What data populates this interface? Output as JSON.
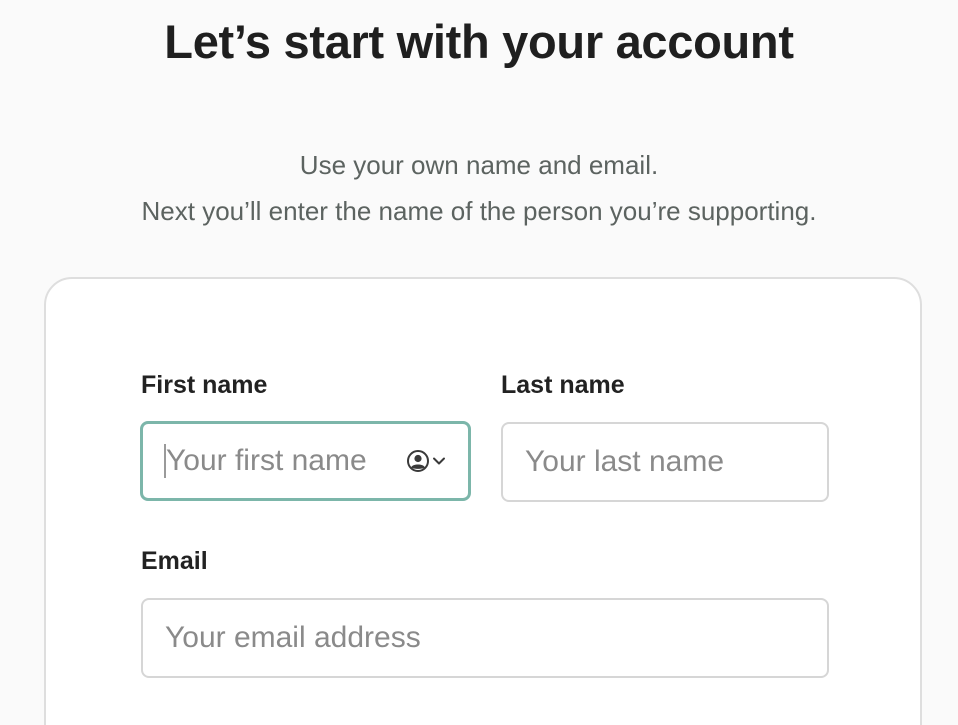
{
  "header": {
    "title": "Let’s start with your account",
    "subtitle_line1": "Use your own name and email.",
    "subtitle_line2": "Next you’ll enter the name of the person you’re supporting."
  },
  "form": {
    "first_name": {
      "label": "First name",
      "placeholder": "Your first name",
      "value": ""
    },
    "last_name": {
      "label": "Last name",
      "placeholder": "Your last name",
      "value": ""
    },
    "email": {
      "label": "Email",
      "placeholder": "Your email address",
      "value": ""
    }
  },
  "icons": {
    "autofill": "person-circle-icon",
    "dropdown": "chevron-down-icon"
  },
  "colors": {
    "focus_border": "#7cb6aa",
    "field_border": "#d6d6d6",
    "card_border": "#dedede",
    "title_text": "#1f1f1f",
    "subtitle_text": "#5c6360"
  }
}
